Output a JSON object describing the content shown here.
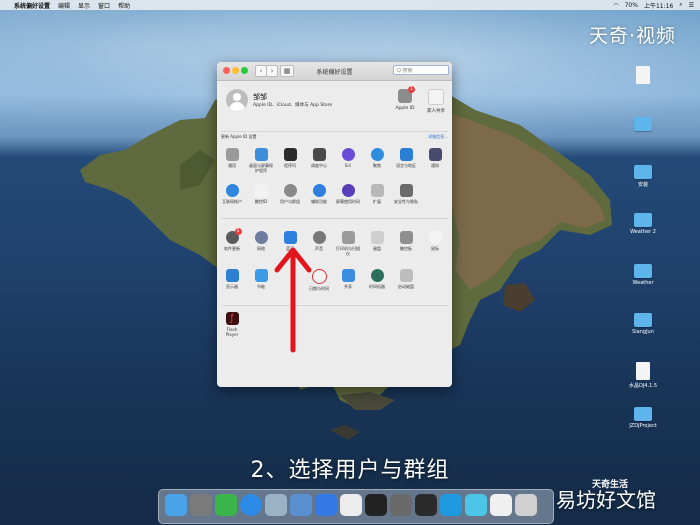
{
  "menubar": {
    "app": "系统偏好设置",
    "items": [
      "编辑",
      "显示",
      "窗口",
      "帮助"
    ],
    "clock": "上午11:16",
    "battery": "70%"
  },
  "watermark_top": "天奇·视频",
  "window": {
    "title": "系统偏好设置",
    "search_placeholder": "Q 搜索",
    "account": {
      "name": "邹邹",
      "subtitle": "Apple ID、iCloud、媒体与 App Store",
      "apple_id_label": "Apple ID",
      "apple_id_badge": "1",
      "family_label": "家人共享"
    },
    "update_notice": "更新 Apple ID 设置",
    "update_link": "详细信息...",
    "row1": [
      "通用",
      "桌面与屏幕保护程序",
      "程序坞",
      "调度中心",
      "Siri",
      "聚焦",
      "语言与地区",
      "通知"
    ],
    "row2": [
      "互联网帐户",
      "触控ID",
      "用户与群组",
      "辅助功能",
      "屏幕使用时间",
      "扩展",
      "安全性与隐私"
    ],
    "row3": [
      "软件更新",
      "网络",
      "蓝牙",
      "声音",
      "打印机与扫描仪",
      "键盘",
      "触控板",
      "鼠标"
    ],
    "row4": [
      "显示器",
      "节能",
      "日期与时间",
      "共享",
      "时间机器",
      "启动磁盘"
    ],
    "row5": [
      "Flash Player"
    ],
    "software_update_badge": "1"
  },
  "desktop_icons": [
    "",
    "",
    "",
    "安装",
    "",
    "Weather 2",
    "Weather",
    "SiangJun",
    "",
    "水晶DJ4.1.5",
    "JZDJProject"
  ],
  "caption": "2、选择用户与群组",
  "watermark_bottom_small": "天奇生活",
  "watermark_bottom": "易坊好文馆",
  "colors": {
    "arrow": "#e3141b",
    "accent": "#2a6ed0"
  }
}
